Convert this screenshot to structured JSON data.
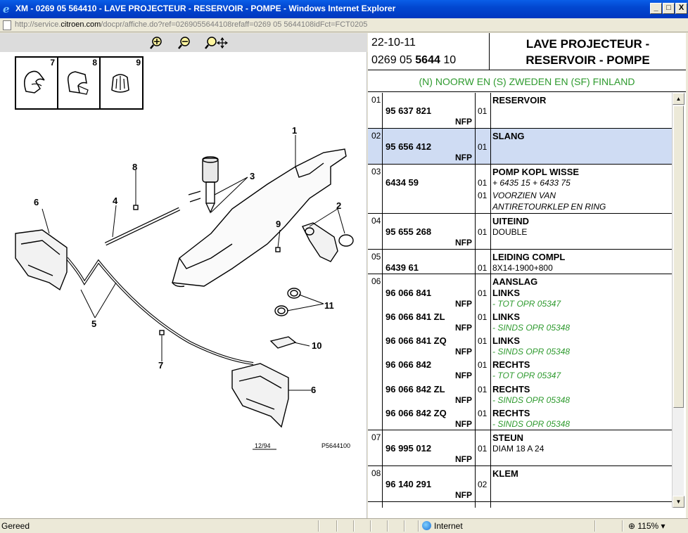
{
  "window": {
    "title": "XM - 0269 05 564410 - LAVE PROJECTEUR - RESERVOIR - POMPE - Windows Internet Explorer",
    "url_prefix": "http://service.",
    "url_domain": "citroen.com",
    "url_rest": "/docpr/affiche.do?ref=0269055644108refaff=0269 05 5644108idFct=FCT0205",
    "minimize": "_",
    "maximize": "□",
    "close": "X"
  },
  "diagram": {
    "thumb_labels": [
      "7",
      "8",
      "9"
    ],
    "callouts": [
      "1",
      "2",
      "3",
      "4",
      "5",
      "6",
      "6",
      "7",
      "8",
      "9",
      "10",
      "11"
    ],
    "stamp": "12/94",
    "code": "P5644100"
  },
  "header": {
    "date": "22-10-11",
    "ref_pre": "0269 05 ",
    "ref_bold": "5644",
    "ref_post": " 10",
    "title_line1": "LAVE PROJECTEUR -",
    "title_line2": "RESERVOIR - POMPE",
    "countries": "(N) NOORW EN (S) ZWEDEN EN (SF) FINLAND"
  },
  "rows": [
    {
      "idx": "01",
      "pn": "95 637 821",
      "nfp": "NFP",
      "qty": "01",
      "desc": "RESERVOIR"
    },
    {
      "idx": "02",
      "pn": "95 656 412",
      "nfp": "NFP",
      "qty": "01",
      "desc": "SLANG"
    },
    {
      "idx": "03",
      "pn": "6434 59",
      "qty1": "01",
      "qty2": "01",
      "desc": "POMP KOPL WISSE",
      "note1": "+ 6435 15 + 6433 75",
      "note2": "VOORZIEN VAN",
      "note3": "ANTIRETOURKLEP EN RING"
    },
    {
      "idx": "04",
      "pn": "95 655 268",
      "nfp": "NFP",
      "qty": "01",
      "desc": "UITEIND",
      "note": "DOUBLE"
    },
    {
      "idx": "05",
      "pn": "6439 61",
      "qty": "01",
      "desc": "LEIDING COMPL",
      "note": "8X14-1900+800"
    },
    {
      "idx": "06",
      "desc": "AANSLAG",
      "items": [
        {
          "pn": "96 066 841",
          "nfp": "NFP",
          "qty": "01",
          "desc": "LINKS",
          "note": "- TOT OPR 05347"
        },
        {
          "pn": "96 066 841 ZL",
          "nfp": "NFP",
          "qty": "01",
          "desc": "LINKS",
          "note": "- SINDS OPR 05348"
        },
        {
          "pn": "96 066 841 ZQ",
          "nfp": "NFP",
          "qty": "01",
          "desc": "LINKS",
          "note": "- SINDS OPR 05348"
        },
        {
          "pn": "96 066 842",
          "nfp": "NFP",
          "qty": "01",
          "desc": "RECHTS",
          "note": "- TOT OPR 05347"
        },
        {
          "pn": "96 066 842 ZL",
          "nfp": "NFP",
          "qty": "01",
          "desc": "RECHTS",
          "note": "- SINDS OPR 05348"
        },
        {
          "pn": "96 066 842 ZQ",
          "nfp": "NFP",
          "qty": "01",
          "desc": "RECHTS",
          "note": "- SINDS OPR 05348"
        }
      ]
    },
    {
      "idx": "07",
      "pn": "96 995 012",
      "nfp": "NFP",
      "qty": "01",
      "desc": "STEUN",
      "note": "DIAM 18 A 24"
    },
    {
      "idx": "08",
      "pn": "96 140 291",
      "nfp": "NFP",
      "qty": "02",
      "desc": "KLEM"
    }
  ],
  "status": {
    "text": "Gereed",
    "zone": "Internet",
    "zoom": "115%"
  },
  "colors": {
    "accent_green": "#2e9a2e",
    "selected_row": "#cfdcf3",
    "titlebar": "#0247d0"
  }
}
